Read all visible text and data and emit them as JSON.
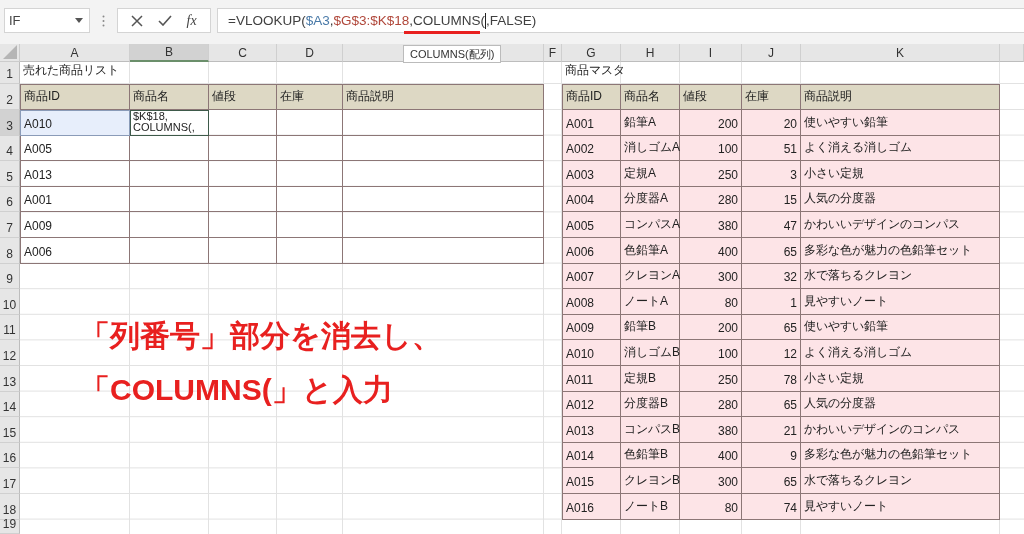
{
  "name_box": {
    "value": "IF"
  },
  "function_button": "fx",
  "formula_bar": {
    "segments": [
      {
        "text": "=VLOOKUP(",
        "kind": "plain"
      },
      {
        "text": "$A3",
        "kind": "ref1"
      },
      {
        "text": ",",
        "kind": "plain"
      },
      {
        "text": "$G$3:$K$18",
        "kind": "ref2"
      },
      {
        "text": ",COLUMNS(",
        "kind": "plain"
      },
      {
        "text": ",FALSE)",
        "kind": "plain",
        "cursor_before": true
      }
    ]
  },
  "tooltip": "COLUMNS(配列)",
  "column_headers": [
    {
      "label": "A",
      "selected": false
    },
    {
      "label": "B",
      "selected": true
    },
    {
      "label": "C",
      "selected": false
    },
    {
      "label": "D",
      "selected": false
    },
    {
      "selected": false
    },
    {
      "label": "F",
      "selected": false
    },
    {
      "label": "G",
      "selected": false
    },
    {
      "label": "H",
      "selected": false
    },
    {
      "label": "I",
      "selected": false
    },
    {
      "label": "J",
      "selected": false
    },
    {
      "label": "K",
      "selected": false
    },
    {
      "selected": false
    }
  ],
  "row_numbers": [
    {
      "label": "1",
      "selected": false
    },
    {
      "label": "2",
      "selected": false
    },
    {
      "label": "3",
      "selected": true
    },
    {
      "label": "4",
      "selected": false
    },
    {
      "label": "5",
      "selected": false
    },
    {
      "label": "6",
      "selected": false
    },
    {
      "label": "7",
      "selected": false
    },
    {
      "label": "8",
      "selected": false
    },
    {
      "label": "9",
      "selected": false
    },
    {
      "label": "10",
      "selected": false
    },
    {
      "label": "11",
      "selected": false
    },
    {
      "label": "12",
      "selected": false
    },
    {
      "label": "13",
      "selected": false
    },
    {
      "label": "14",
      "selected": false
    },
    {
      "label": "15",
      "selected": false
    },
    {
      "label": "16",
      "selected": false
    },
    {
      "label": "17",
      "selected": false
    },
    {
      "label": "18",
      "selected": false
    },
    {
      "label": "19",
      "selected": false
    }
  ],
  "sold_list": {
    "title": "売れた商品リスト",
    "columns": [
      "商品ID",
      "商品名",
      "値段",
      "在庫",
      "商品説明"
    ],
    "rows": [
      {
        "id": "A010",
        "selected": true,
        "name_input": "$K$18,\nCOLUMNS(,"
      },
      {
        "id": "A005",
        "selected": false
      },
      {
        "id": "A013",
        "selected": false
      },
      {
        "id": "A001",
        "selected": false
      },
      {
        "id": "A009",
        "selected": false
      },
      {
        "id": "A006",
        "selected": false
      }
    ]
  },
  "product_master": {
    "title": "商品マスタ",
    "columns": [
      "商品ID",
      "商品名",
      "値段",
      "在庫",
      "商品説明"
    ],
    "rows": [
      {
        "id": "A001",
        "name": "鉛筆A",
        "price": "200",
        "stock": "20",
        "description": "使いやすい鉛筆"
      },
      {
        "id": "A002",
        "name": "消しゴムA",
        "price": "100",
        "stock": "51",
        "description": "よく消える消しゴム"
      },
      {
        "id": "A003",
        "name": "定規A",
        "price": "250",
        "stock": "3",
        "description": "小さい定規"
      },
      {
        "id": "A004",
        "name": "分度器A",
        "price": "280",
        "stock": "15",
        "description": "人気の分度器"
      },
      {
        "id": "A005",
        "name": "コンパスA",
        "price": "380",
        "stock": "47",
        "description": "かわいいデザインのコンパス"
      },
      {
        "id": "A006",
        "name": "色鉛筆A",
        "price": "400",
        "stock": "65",
        "description": "多彩な色が魅力の色鉛筆セット"
      },
      {
        "id": "A007",
        "name": "クレヨンA",
        "price": "300",
        "stock": "32",
        "description": "水で落ちるクレヨン"
      },
      {
        "id": "A008",
        "name": "ノートA",
        "price": "80",
        "stock": "1",
        "description": "見やすいノート"
      },
      {
        "id": "A009",
        "name": "鉛筆B",
        "price": "200",
        "stock": "65",
        "description": "使いやすい鉛筆"
      },
      {
        "id": "A010",
        "name": "消しゴムB",
        "price": "100",
        "stock": "12",
        "description": "よく消える消しゴム"
      },
      {
        "id": "A011",
        "name": "定規B",
        "price": "250",
        "stock": "78",
        "description": "小さい定規"
      },
      {
        "id": "A012",
        "name": "分度器B",
        "price": "280",
        "stock": "65",
        "description": "人気の分度器"
      },
      {
        "id": "A013",
        "name": "コンパスB",
        "price": "380",
        "stock": "21",
        "description": "かわいいデザインのコンパス"
      },
      {
        "id": "A014",
        "name": "色鉛筆B",
        "price": "400",
        "stock": "9",
        "description": "多彩な色が魅力の色鉛筆セット"
      },
      {
        "id": "A015",
        "name": "クレヨンB",
        "price": "300",
        "stock": "65",
        "description": "水で落ちるクレヨン"
      },
      {
        "id": "A016",
        "name": "ノートB",
        "price": "80",
        "stock": "74",
        "description": "見やすいノート"
      }
    ]
  },
  "annotation": {
    "lines": [
      "「列番号」部分を消去し、",
      "「COLUMNS(」と入力"
    ]
  }
}
